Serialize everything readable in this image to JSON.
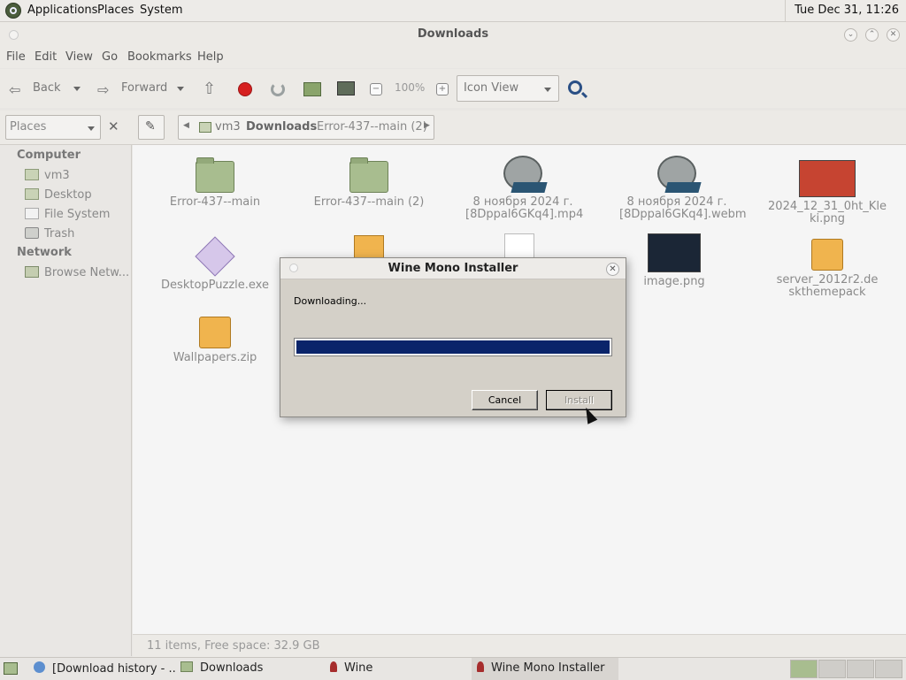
{
  "top_panel": {
    "menus": [
      "Applications",
      "Places",
      "System"
    ],
    "clock": "Tue Dec 31, 11:26"
  },
  "window": {
    "title": "Downloads",
    "menubar": [
      "File",
      "Edit",
      "View",
      "Go",
      "Bookmarks",
      "Help"
    ],
    "toolbar": {
      "back_label": "Back",
      "forward_label": "Forward",
      "zoom_level": "100%",
      "view_mode": "Icon View"
    },
    "location": {
      "side_pane_selector": "Places",
      "path": [
        "vm3",
        "Downloads",
        "Error-437--main (2)"
      ]
    },
    "sidebar": {
      "computer_heading": "Computer",
      "computer_items": [
        "vm3",
        "Desktop",
        "File System",
        "Trash"
      ],
      "network_heading": "Network",
      "network_items": [
        "Browse Netw..."
      ]
    },
    "files": [
      {
        "name": "Error-437--main",
        "icon": "folder-icon"
      },
      {
        "name": "Error-437--main (2)",
        "icon": "folder-icon"
      },
      {
        "name": "8 ноября 2024 г. [8Dppal6GKq4].mp4",
        "icon": "video-icon"
      },
      {
        "name": "8 ноября 2024 г. [8Dppal6GKq4].webm",
        "icon": "video-icon"
      },
      {
        "name": "2024_12_31_0ht_Kleki.png",
        "icon": "image-thumbnail"
      },
      {
        "name": "DesktopPuzzle.exe",
        "icon": "executable-icon"
      },
      {
        "name": "image.png",
        "icon": "image-thumbnail"
      },
      {
        "name": "server_2012r2.deskthemepack",
        "icon": "package-icon"
      },
      {
        "name": "Wallpapers.zip",
        "icon": "archive-icon"
      }
    ],
    "status": "11 items, Free space: 32.9 GB"
  },
  "dialog": {
    "title": "Wine Mono Installer",
    "message": "Downloading...",
    "progress": 1.0,
    "cancel_label": "Cancel",
    "install_label": "Install"
  },
  "taskbar": {
    "tasks": [
      "[Download history - ...",
      "Downloads",
      "Wine",
      "Wine Mono Installer"
    ]
  },
  "colors": {
    "progress_fill": "#0a246a",
    "folder": "#a8bd8f",
    "stop": "#d62020"
  }
}
